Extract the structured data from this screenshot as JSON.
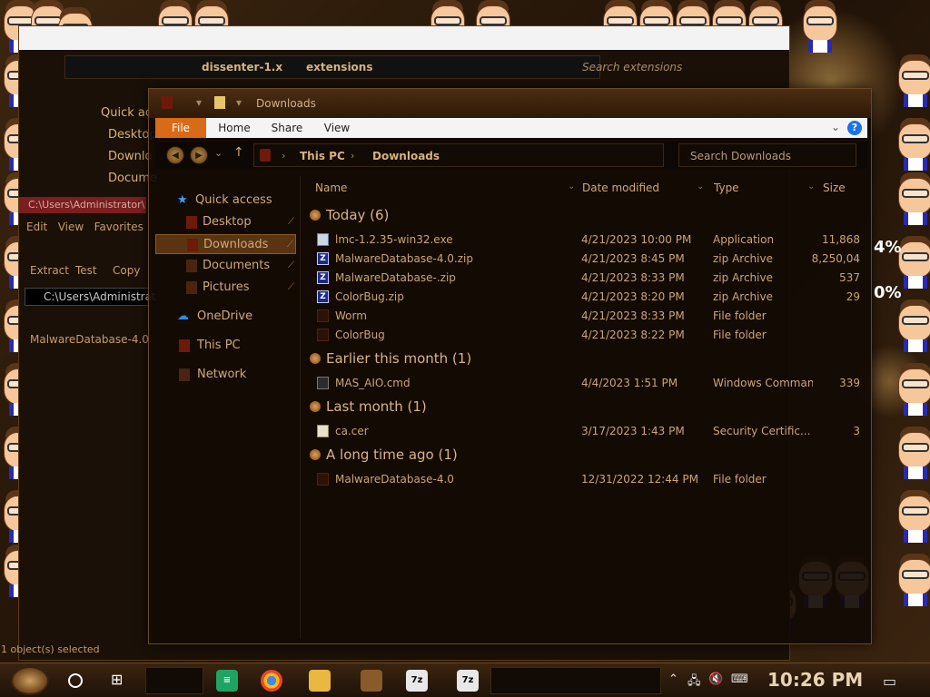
{
  "background_window": {
    "address": [
      "dissenter-1.x",
      "extensions"
    ],
    "search_placeholder": "Search extensions",
    "quick_access": [
      "Quick acc",
      "Desktop",
      "Downlo",
      "Docume"
    ],
    "user_path": "C:\\Users\\Administrator\\",
    "menu": [
      "Edit",
      "View",
      "Favorites"
    ],
    "tools": [
      "Extract",
      "Test",
      "Copy"
    ],
    "path": "C:\\Users\\Administrat",
    "item": "MalwareDatabase-4.0",
    "status": "1 object(s) selected"
  },
  "window": {
    "title": "Downloads",
    "ribbon_tabs": [
      "File",
      "Home",
      "Share",
      "View"
    ],
    "help": "?",
    "breadcrumb": [
      "This PC",
      "Downloads"
    ],
    "search_placeholder": "Search Downloads"
  },
  "nav": {
    "quick_access": "Quick access",
    "items": [
      {
        "label": "Desktop",
        "pinned": true
      },
      {
        "label": "Downloads",
        "pinned": true,
        "selected": true
      },
      {
        "label": "Documents",
        "pinned": true
      },
      {
        "label": "Pictures",
        "pinned": true
      }
    ],
    "onedrive": "OneDrive",
    "thispc": "This PC",
    "network": "Network"
  },
  "columns": {
    "name": "Name",
    "date": "Date modified",
    "type": "Type",
    "size": "Size"
  },
  "groups": [
    {
      "label": "Today (6)",
      "files": [
        {
          "name": "lmc-1.2.35-win32.exe",
          "date": "4/21/2023 10:00 PM",
          "type": "Application",
          "size": "11,868",
          "icon": "exe"
        },
        {
          "name": "MalwareDatabase-4.0.zip",
          "date": "4/21/2023 8:45 PM",
          "type": "zip Archive",
          "size": "8,250,04",
          "icon": "zip"
        },
        {
          "name": "MalwareDatabase-.zip",
          "date": "4/21/2023 8:33 PM",
          "type": "zip Archive",
          "size": "537",
          "icon": "zip"
        },
        {
          "name": "ColorBug.zip",
          "date": "4/21/2023 8:20 PM",
          "type": "zip Archive",
          "size": "29",
          "icon": "zip"
        },
        {
          "name": "Worm",
          "date": "4/21/2023 8:33 PM",
          "type": "File folder",
          "size": "",
          "icon": "folder"
        },
        {
          "name": "ColorBug",
          "date": "4/21/2023 8:22 PM",
          "type": "File folder",
          "size": "",
          "icon": "folder"
        }
      ]
    },
    {
      "label": "Earlier this month (1)",
      "files": [
        {
          "name": "MAS_AIO.cmd",
          "date": "4/4/2023 1:51 PM",
          "type": "Windows Comman...",
          "size": "339",
          "icon": "cmd"
        }
      ]
    },
    {
      "label": "Last month (1)",
      "files": [
        {
          "name": "ca.cer",
          "date": "3/17/2023 1:43 PM",
          "type": "Security Certific...",
          "size": "3",
          "icon": "cer"
        }
      ]
    },
    {
      "label": "A long time ago (1)",
      "files": [
        {
          "name": "MalwareDatabase-4.0",
          "date": "12/31/2022 12:44 PM",
          "type": "File folder",
          "size": "",
          "icon": "folder"
        }
      ]
    }
  ],
  "desktop_overlay": {
    "pct1": "4%",
    "pct2": "0%"
  },
  "taskbar": {
    "apps": [
      "sheets",
      "chrome",
      "explorer",
      "winrar",
      "7z",
      "7z"
    ],
    "app_labels": {
      "sevenzip": "7z"
    },
    "clock": "10:26 PM"
  },
  "colors": {
    "accent": "#d96a17",
    "text": "#cfa97a",
    "selection": "#5a3412"
  }
}
